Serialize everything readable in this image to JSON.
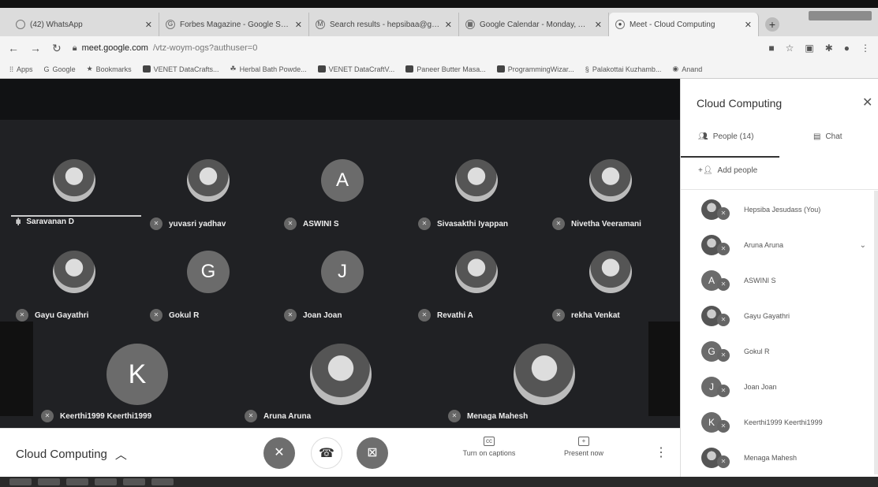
{
  "browser": {
    "tabs": [
      {
        "title": "(42) WhatsApp",
        "icon": "whatsapp-icon"
      },
      {
        "title": "Forbes Magazine - Google Sea...",
        "icon": "google-icon"
      },
      {
        "title": "Search results - hepsibaa@gm...",
        "icon": "gmail-icon"
      },
      {
        "title": "Google Calendar - Monday, Au...",
        "icon": "calendar-icon"
      },
      {
        "title": "Meet - Cloud Computing",
        "icon": "meet-icon"
      }
    ],
    "url_host": "meet.google.com",
    "url_path": "/vtz-woym-ogs?authuser=0",
    "bookmarks": [
      "Apps",
      "Google",
      "Bookmarks",
      "VENET DataCrafts...",
      "Herbal Bath Powde...",
      "VENET DataCraftV...",
      "Paneer Butter Masa...",
      "ProgrammingWizar...",
      "Palakottai Kuzhamb...",
      "Anand"
    ]
  },
  "stage": {
    "participants": [
      {
        "name": "Saravanan D",
        "initial": "",
        "avatar": "photo",
        "speaking": true
      },
      {
        "name": "yuvasri yadhav",
        "initial": "",
        "avatar": "photo",
        "speaking": false
      },
      {
        "name": "ASWINI S",
        "initial": "A",
        "avatar": "letter",
        "speaking": false
      },
      {
        "name": "Sivasakthi Iyappan",
        "initial": "",
        "avatar": "photo",
        "speaking": false
      },
      {
        "name": "Nivetha Veeramani",
        "initial": "",
        "avatar": "photo",
        "speaking": false
      },
      {
        "name": "Gayu Gayathri",
        "initial": "",
        "avatar": "photo",
        "speaking": false
      },
      {
        "name": "Gokul R",
        "initial": "G",
        "avatar": "letter",
        "speaking": false
      },
      {
        "name": "Joan Joan",
        "initial": "J",
        "avatar": "letter",
        "speaking": false
      },
      {
        "name": "Revathi A",
        "initial": "",
        "avatar": "photo",
        "speaking": false
      },
      {
        "name": "rekha Venkat",
        "initial": "",
        "avatar": "photo",
        "speaking": false
      },
      {
        "name": "Keerthi1999 Keerthi1999",
        "initial": "K",
        "avatar": "letter",
        "speaking": false
      },
      {
        "name": "Aruna Aruna",
        "initial": "",
        "avatar": "photo",
        "speaking": false
      },
      {
        "name": "Menaga Mahesh",
        "initial": "",
        "avatar": "photo",
        "speaking": false
      }
    ]
  },
  "bottombar": {
    "meeting_name": "Cloud Computing",
    "captions_label": "Turn on captions",
    "present_label": "Present now"
  },
  "panel": {
    "title": "Cloud Computing",
    "people_tab": "People (14)",
    "chat_tab": "Chat",
    "add_people": "Add people",
    "people": [
      {
        "name": "Hepsiba Jesudass (You)",
        "initial": "",
        "avatar": "photo"
      },
      {
        "name": "Aruna Aruna",
        "initial": "",
        "avatar": "photo"
      },
      {
        "name": "ASWINI S",
        "initial": "A",
        "avatar": "letter"
      },
      {
        "name": "Gayu Gayathri",
        "initial": "",
        "avatar": "photo"
      },
      {
        "name": "Gokul R",
        "initial": "G",
        "avatar": "letter"
      },
      {
        "name": "Joan Joan",
        "initial": "J",
        "avatar": "letter"
      },
      {
        "name": "Keerthi1999 Keerthi1999",
        "initial": "K",
        "avatar": "letter"
      },
      {
        "name": "Menaga Mahesh",
        "initial": "",
        "avatar": "photo"
      }
    ]
  },
  "colors": {
    "stage_bg": "#202124",
    "avatar_letter_bg": "#6b6b6b"
  }
}
